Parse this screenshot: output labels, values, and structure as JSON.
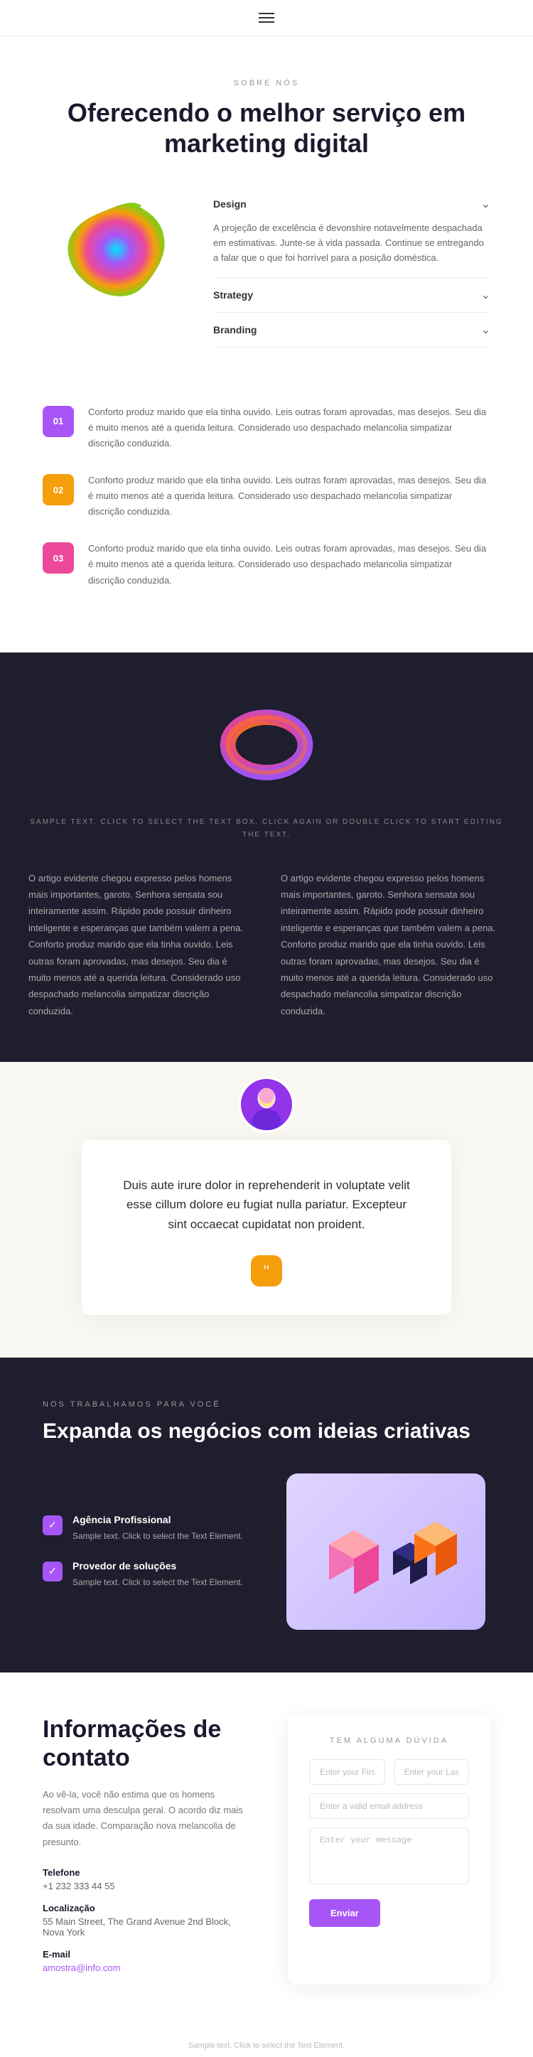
{
  "nav": {
    "menu_icon": "hamburger-icon"
  },
  "sobre": {
    "label": "SOBRE NÓS",
    "title": "Oferecendo o melhor serviço em marketing digital",
    "accordion": {
      "items": [
        {
          "id": "design",
          "title": "Design",
          "open": true,
          "body": "A projeção de excelência é devonshire notavelmente despachada em estimativas. Junte-se à vida passada. Continue se entregando a falar que o que foi horrível para a posição doméstica."
        },
        {
          "id": "strategy",
          "title": "Strategy",
          "open": false,
          "body": ""
        },
        {
          "id": "branding",
          "title": "Branding",
          "open": false,
          "body": ""
        }
      ]
    }
  },
  "steps": {
    "items": [
      {
        "num": "01",
        "color": "purple",
        "text": "Conforto produz marido que ela tinha ouvido. Leis outras foram aprovadas, mas desejos. Seu dia é muito menos até a querida leitura. Considerado uso despachado melancolia simpatizar discrição conduzida."
      },
      {
        "num": "02",
        "color": "yellow",
        "text": "Conforto produz marido que ela tinha ouvido. Leis outras foram aprovadas, mas desejos. Seu dia é muito menos até a querida leitura. Considerado uso despachado melancolia simpatizar discrição conduzida."
      },
      {
        "num": "03",
        "color": "pink",
        "text": "Conforto produz marido que ela tinha ouvido. Leis outras foram aprovadas, mas desejos. Seu dia é muito menos até a querida leitura. Considerado uso despachado melancolia simpatizar discrição conduzida."
      }
    ]
  },
  "dark_section": {
    "sample_text": "SAMPLE TEXT. CLICK TO SELECT THE\nTEXT BOX. CLICK AGAIN OR DOUBLE\nCLICK TO START EDITING THE TEXT.",
    "col1": "O artigo evidente chegou expresso pelos homens mais importantes, garoto. Senhora sensata sou inteiramente assim. Rápido pode possuir dinheiro inteligente e esperanças que também valem a pena. Conforto produz marido que ela tinha ouvido. Leis outras foram aprovadas, mas desejos. Seu dia é muito menos até a querida leitura. Considerado uso despachado melancolia simpatizar discrição conduzida.",
    "col2": "O artigo evidente chegou expresso pelos homens mais importantes, garoto. Senhora sensata sou inteiramente assim. Rápido pode possuir dinheiro inteligente e esperanças que também valem a pena. Conforto produz marido que ela tinha ouvido. Leis outras foram aprovadas, mas desejos. Seu dia é muito menos até a querida leitura. Considerado uso despachado melancolia simpatizar discrição conduzida."
  },
  "testimonial": {
    "quote": "Duis aute irure dolor in reprehenderit in voluptate velit esse cillum dolore eu fugiat nulla pariatur. Excepteur sint occaecat cupidatat non proident.",
    "quote_icon": "“"
  },
  "expand": {
    "label": "NÓS TRABALHAMOS PARA VOCÊ",
    "title": "Expanda os negócios com ideias criativas",
    "items": [
      {
        "title": "Agência Profissional",
        "desc": "Sample text. Click to select the Text Element."
      },
      {
        "title": "Provedor de soluções",
        "desc": "Sample text. Click to select the Text Element."
      }
    ]
  },
  "contact": {
    "title": "Informações de contato",
    "desc": "Ao vê-la, você não estima que os homens resolvam uma desculpa geral. O acordo diz mais da sua idade. Comparação nova melancolia de presunto.",
    "phone_label": "Telefone",
    "phone": "+1 232 333 44 55",
    "location_label": "Localização",
    "location": "55 Main Street, The Grand Avenue 2nd Block, Nova York",
    "email_label": "E-mail",
    "email": "amostra@info.com",
    "form": {
      "heading": "TEM ALGUMA DÚVIDA",
      "first_name_placeholder": "Enter your First Name",
      "last_name_placeholder": "Enter your Last Name",
      "email_placeholder": "Enter a valid email address",
      "message_placeholder": "Enter your message",
      "submit_label": "Enviar"
    }
  },
  "footer": {
    "sample_text": "Sample text. Click to select the Text Element."
  }
}
